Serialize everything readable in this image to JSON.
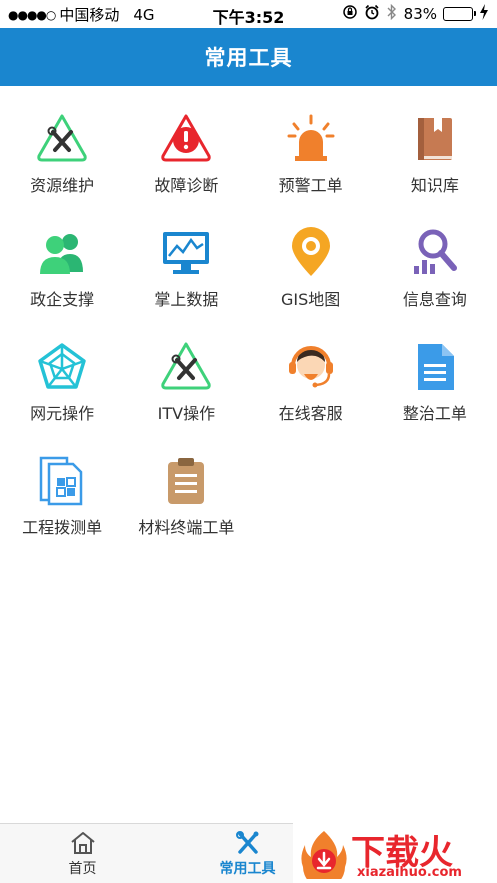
{
  "status_bar": {
    "carrier": "中国移动",
    "network": "4G",
    "time": "下午3:52",
    "battery_percent": "83%",
    "battery_level": 0.83
  },
  "header": {
    "title": "常用工具"
  },
  "tiles": [
    {
      "label": "资源维护",
      "icon": "wrench-screwdriver-icon"
    },
    {
      "label": "故障诊断",
      "icon": "alert-triangle-icon"
    },
    {
      "label": "预警工单",
      "icon": "siren-icon"
    },
    {
      "label": "知识库",
      "icon": "book-icon"
    },
    {
      "label": "政企支撑",
      "icon": "users-icon"
    },
    {
      "label": "掌上数据",
      "icon": "monitor-chart-icon"
    },
    {
      "label": "GIS地图",
      "icon": "map-pin-icon"
    },
    {
      "label": "信息查询",
      "icon": "search-chart-icon"
    },
    {
      "label": "网元操作",
      "icon": "network-pentagon-icon"
    },
    {
      "label": "ITV操作",
      "icon": "wrench-screwdriver-icon"
    },
    {
      "label": "在线客服",
      "icon": "headset-icon"
    },
    {
      "label": "整治工单",
      "icon": "document-icon"
    },
    {
      "label": "工程拨测单",
      "icon": "file-grid-icon"
    },
    {
      "label": "材料终端工单",
      "icon": "clipboard-icon"
    }
  ],
  "tabbar": {
    "home_label": "首页",
    "tools_label": "常用工具"
  },
  "watermark": {
    "text": "下载火",
    "sub": "xiazaihuo.com"
  },
  "colors": {
    "brand_blue": "#1a86cf",
    "green": "#3ed17a",
    "red": "#e8262d",
    "orange": "#f0802c",
    "brown": "#c67a52",
    "purple": "#7a62b8",
    "cyan": "#24c2d6",
    "file_blue": "#3b9be8",
    "tan": "#c89a6a"
  }
}
